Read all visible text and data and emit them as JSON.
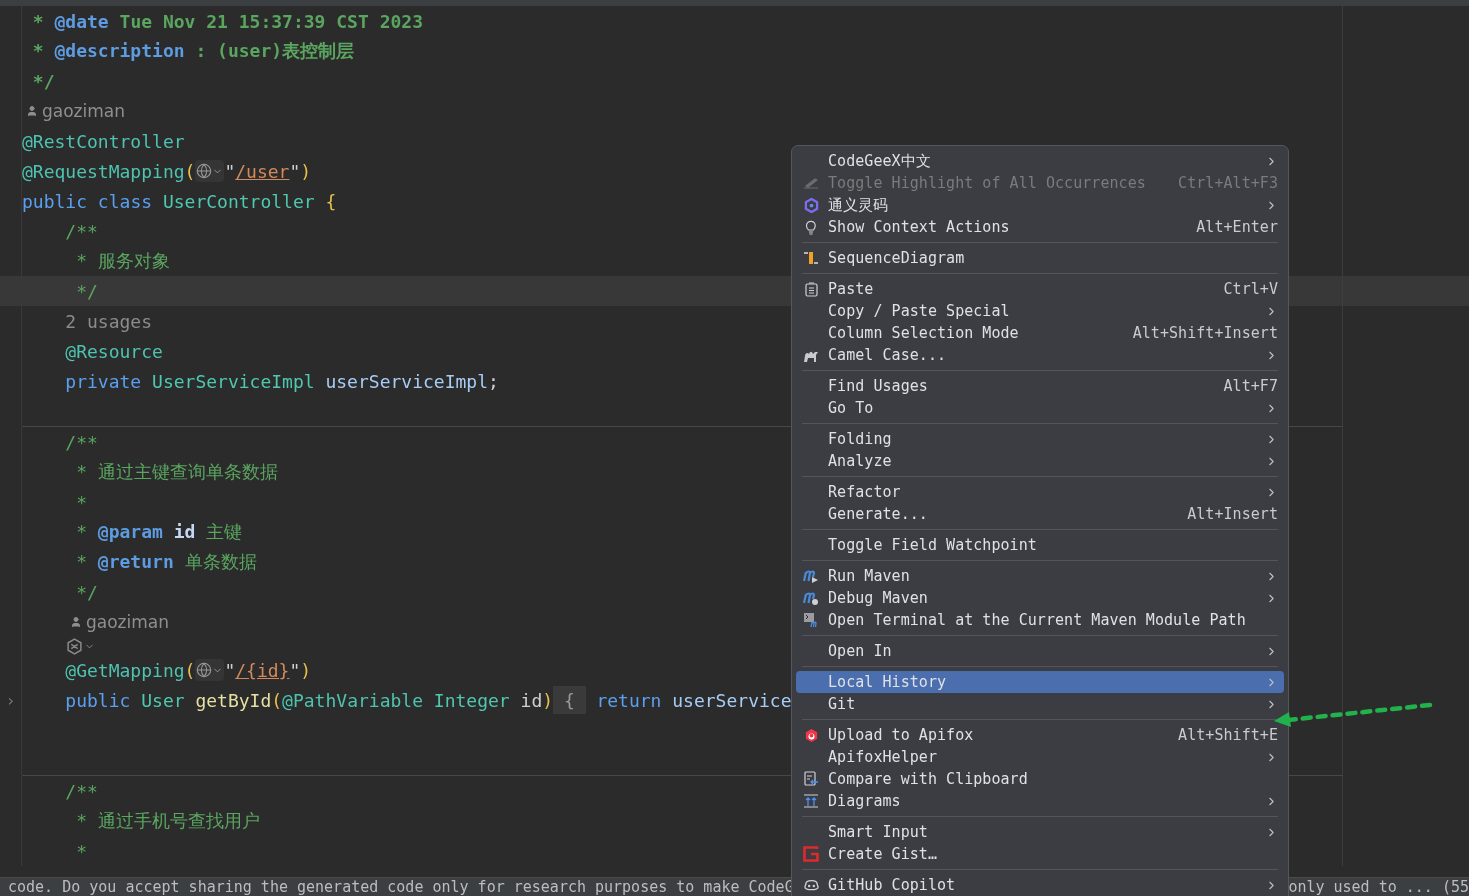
{
  "editor": {
    "blocks": [
      {
        "lines": [
          {
            "kind": "code",
            "tokens": [
              {
                "kind": "doccomment",
                "text": " * "
              },
              {
                "kind": "doctag",
                "text": "@date"
              },
              {
                "kind": "doccomment",
                "text": " Tue Nov 21 15:37:39 CST 2023"
              }
            ]
          },
          {
            "kind": "code",
            "tokens": [
              {
                "kind": "doccomment",
                "text": " * "
              },
              {
                "kind": "doctag",
                "text": "@description"
              },
              {
                "kind": "doccomment",
                "text": " : (user)表控制层"
              }
            ]
          },
          {
            "kind": "code",
            "tokens": [
              {
                "kind": "doccomment",
                "text": " */"
              }
            ]
          },
          {
            "kind": "author",
            "indented": false,
            "text": "gaoziman"
          },
          {
            "kind": "code",
            "tokens": [
              {
                "kind": "annotation",
                "text": "@RestController"
              }
            ]
          },
          {
            "kind": "code",
            "tokens": [
              {
                "kind": "annotation",
                "text": "@RequestMapping"
              },
              {
                "kind": "paren",
                "text": "("
              },
              {
                "kind": "globe"
              },
              {
                "kind": "string",
                "text": "\""
              },
              {
                "kind": "url",
                "text": "/user"
              },
              {
                "kind": "string",
                "text": "\""
              },
              {
                "kind": "paren",
                "text": ")"
              }
            ]
          },
          {
            "kind": "code",
            "tokens": [
              {
                "kind": "keyword",
                "text": "public"
              },
              {
                "kind": "keyword",
                "text": " class"
              },
              {
                "kind": "type",
                "text": " UserController"
              },
              {
                "kind": "paren",
                "text": " {"
              }
            ]
          },
          {
            "kind": "code",
            "tokens": [
              {
                "kind": "comment",
                "text": "    /**"
              }
            ]
          },
          {
            "kind": "code",
            "tokens": [
              {
                "kind": "comment",
                "text": "     * 服务对象"
              }
            ]
          },
          {
            "kind": "code",
            "current": true,
            "tokens": [
              {
                "kind": "comment",
                "text": "     */"
              }
            ]
          },
          {
            "kind": "code",
            "tokens": [
              {
                "kind": "hint",
                "text": "    2 usages"
              }
            ]
          },
          {
            "kind": "code",
            "tokens": [
              {
                "kind": "annotation",
                "text": "    @Resource"
              }
            ]
          },
          {
            "kind": "code",
            "tokens": [
              {
                "kind": "keyword",
                "text": "    private"
              },
              {
                "kind": "type",
                "text": " UserServiceImpl"
              },
              {
                "kind": "field",
                "text": " userServiceImpl"
              },
              {
                "kind": "plain",
                "text": ";"
              }
            ]
          },
          {
            "kind": "blank"
          }
        ]
      },
      {
        "lines": [
          {
            "kind": "code",
            "tokens": [
              {
                "kind": "comment",
                "text": "    /**"
              }
            ]
          },
          {
            "kind": "code",
            "tokens": [
              {
                "kind": "comment",
                "text": "     * 通过主键查询单条数据"
              }
            ]
          },
          {
            "kind": "code",
            "tokens": [
              {
                "kind": "comment",
                "text": "     *"
              }
            ]
          },
          {
            "kind": "code",
            "tokens": [
              {
                "kind": "comment",
                "text": "     * "
              },
              {
                "kind": "doctag",
                "text": "@param"
              },
              {
                "kind": "param",
                "text": " id"
              },
              {
                "kind": "comment",
                "text": " 主键"
              }
            ]
          },
          {
            "kind": "code",
            "tokens": [
              {
                "kind": "comment",
                "text": "     * "
              },
              {
                "kind": "doctag",
                "text": "@return"
              },
              {
                "kind": "comment",
                "text": " 单条数据"
              }
            ]
          },
          {
            "kind": "code",
            "tokens": [
              {
                "kind": "comment",
                "text": "     */"
              }
            ]
          },
          {
            "kind": "author",
            "indented": true,
            "text": "gaoziman"
          },
          {
            "kind": "ai-hint",
            "indented": true
          },
          {
            "kind": "code",
            "tokens": [
              {
                "kind": "annotation",
                "text": "    @GetMapping"
              },
              {
                "kind": "paren",
                "text": "("
              },
              {
                "kind": "globe"
              },
              {
                "kind": "string",
                "text": "\""
              },
              {
                "kind": "url",
                "text": "/{id}"
              },
              {
                "kind": "string",
                "text": "\""
              },
              {
                "kind": "paren",
                "text": ")"
              }
            ]
          },
          {
            "kind": "code",
            "gutter": "›",
            "tokens": [
              {
                "kind": "keyword",
                "text": "    public"
              },
              {
                "kind": "type",
                "text": " User"
              },
              {
                "kind": "method",
                "text": " getById"
              },
              {
                "kind": "paren",
                "text": "("
              },
              {
                "kind": "annotation",
                "text": "@PathVariable"
              },
              {
                "kind": "type",
                "text": " Integer"
              },
              {
                "kind": "plain",
                "text": " id"
              },
              {
                "kind": "paren",
                "text": ")"
              },
              {
                "kind": "fold",
                "text": " { "
              },
              {
                "kind": "keyword",
                "text": " return"
              },
              {
                "kind": "field",
                "text": " userService"
              }
            ]
          },
          {
            "kind": "blank"
          },
          {
            "kind": "blank"
          }
        ]
      },
      {
        "lines": [
          {
            "kind": "code",
            "tokens": [
              {
                "kind": "comment",
                "text": "    /**"
              }
            ]
          },
          {
            "kind": "code",
            "tokens": [
              {
                "kind": "comment",
                "text": "     * 通过手机号查找用户"
              }
            ]
          },
          {
            "kind": "code",
            "tokens": [
              {
                "kind": "comment",
                "text": "     *"
              }
            ]
          }
        ]
      }
    ]
  },
  "context_menu": {
    "groups": [
      [
        {
          "label": "CodeGeeX中文",
          "kind": "plain",
          "submenu": true,
          "disabled": false,
          "selected": false
        },
        {
          "label": "Toggle Highlight of All Occurrences",
          "kind": "pen",
          "shortcut": "Ctrl+Alt+F3",
          "submenu": false,
          "disabled": true,
          "selected": false
        },
        {
          "label": "通义灵码",
          "kind": "swirl",
          "submenu": true,
          "disabled": false,
          "selected": false
        },
        {
          "label": "Show Context Actions",
          "kind": "bulb",
          "shortcut": "Alt+Enter",
          "submenu": false,
          "disabled": false,
          "selected": false
        }
      ],
      [
        {
          "label": "SequenceDiagram",
          "kind": "sequence",
          "submenu": false,
          "disabled": false,
          "selected": false
        }
      ],
      [
        {
          "label": "Paste",
          "kind": "clipboard",
          "shortcut": "Ctrl+V",
          "submenu": false,
          "disabled": false,
          "selected": false
        },
        {
          "label": "Copy / Paste Special",
          "kind": "plain",
          "submenu": true,
          "disabled": false,
          "selected": false
        },
        {
          "label": "Column Selection Mode",
          "kind": "plain",
          "shortcut": "Alt+Shift+Insert",
          "submenu": false,
          "disabled": false,
          "selected": false
        },
        {
          "label": "Camel Case...",
          "kind": "camel",
          "submenu": true,
          "disabled": false,
          "selected": false
        }
      ],
      [
        {
          "label": "Find Usages",
          "kind": "plain",
          "shortcut": "Alt+F7",
          "submenu": false,
          "disabled": false,
          "selected": false
        },
        {
          "label": "Go To",
          "kind": "plain",
          "submenu": true,
          "disabled": false,
          "selected": false
        }
      ],
      [
        {
          "label": "Folding",
          "kind": "plain",
          "submenu": true,
          "disabled": false,
          "selected": false
        },
        {
          "label": "Analyze",
          "kind": "plain",
          "submenu": true,
          "disabled": false,
          "selected": false
        }
      ],
      [
        {
          "label": "Refactor",
          "kind": "plain",
          "submenu": true,
          "disabled": false,
          "selected": false
        },
        {
          "label": "Generate...",
          "kind": "plain",
          "shortcut": "Alt+Insert",
          "submenu": false,
          "disabled": false,
          "selected": false
        }
      ],
      [
        {
          "label": "Toggle Field Watchpoint",
          "kind": "plain",
          "submenu": false,
          "disabled": false,
          "selected": false
        }
      ],
      [
        {
          "label": "Run Maven",
          "kind": "maven-run",
          "submenu": true,
          "disabled": false,
          "selected": false
        },
        {
          "label": "Debug Maven",
          "kind": "maven-debug",
          "submenu": true,
          "disabled": false,
          "selected": false
        },
        {
          "label": "Open Terminal at the Current Maven Module Path",
          "kind": "maven-terminal",
          "submenu": false,
          "disabled": false,
          "selected": false
        }
      ],
      [
        {
          "label": "Open In",
          "kind": "plain",
          "submenu": true,
          "disabled": false,
          "selected": false
        }
      ],
      [
        {
          "label": "Local History",
          "kind": "plain",
          "submenu": true,
          "disabled": false,
          "selected": true
        },
        {
          "label": "Git",
          "kind": "plain",
          "submenu": true,
          "disabled": false,
          "selected": false
        }
      ],
      [
        {
          "label": "Upload to Apifox",
          "kind": "apifox",
          "shortcut": "Alt+Shift+E",
          "submenu": false,
          "disabled": false,
          "selected": false
        },
        {
          "label": "ApifoxHelper",
          "kind": "plain",
          "submenu": true,
          "disabled": false,
          "selected": false
        },
        {
          "label": "Compare with Clipboard",
          "kind": "compare",
          "submenu": false,
          "disabled": false,
          "selected": false
        },
        {
          "label": "Diagrams",
          "kind": "diagram",
          "submenu": true,
          "disabled": false,
          "selected": false
        }
      ],
      [
        {
          "label": "Smart Input",
          "kind": "plain",
          "submenu": true,
          "disabled": false,
          "selected": false
        },
        {
          "label": "Create Gist…",
          "kind": "gist",
          "submenu": false,
          "disabled": false,
          "selected": false
        }
      ],
      [
        {
          "label": "GitHub Copilot",
          "kind": "copilot",
          "submenu": true,
          "disabled": false,
          "selected": false
        }
      ]
    ]
  },
  "status_bar": {
    "left": "code. Do you accept sharing the generated code only for research purposes to make CodeG",
    "right": "only used to ... (55"
  }
}
